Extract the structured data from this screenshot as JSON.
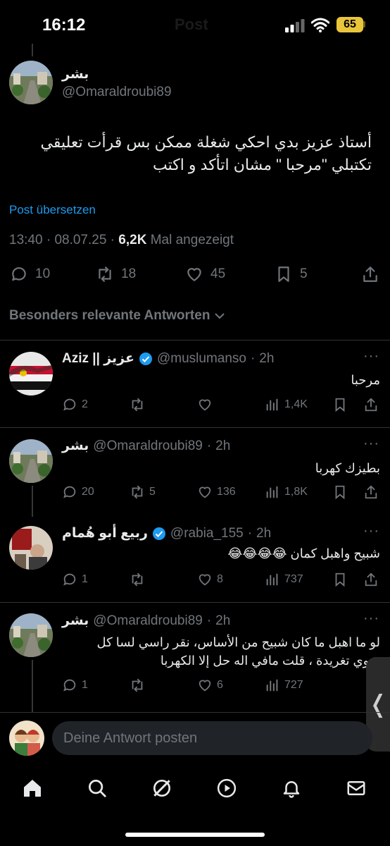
{
  "status_bar": {
    "time": "16:12",
    "faded_title": "Post",
    "battery": "65"
  },
  "post": {
    "author_name": "بشر",
    "author_handle": "@Omaraldroubi89",
    "text": "أستاذ عزيز بدي احكي شغلة ممكن بس قرأت تعليقي تكتبلي \"مرحبا \" مشان اتأكد و اكتب",
    "translate": "Post übersetzen",
    "time": "13:40",
    "date": "08.07.25",
    "views": "6,2K",
    "views_label": "Mal angezeigt",
    "stats": {
      "replies": "10",
      "reposts": "18",
      "likes": "45",
      "bookmarks": "5"
    }
  },
  "relevant_label": "Besonders relevante Antworten",
  "replies": [
    {
      "name": "Aziz || عزيز",
      "verified": true,
      "handle": "@muslumanso",
      "time": "2h",
      "text": "مرحبا",
      "stats": {
        "replies": "2",
        "reposts": "",
        "likes": "",
        "views": "1,4K"
      }
    },
    {
      "name": "بشر",
      "verified": false,
      "handle": "@Omaraldroubi89",
      "time": "2h",
      "text": "بطيزك كهربا",
      "stats": {
        "replies": "20",
        "reposts": "5",
        "likes": "136",
        "views": "1,8K"
      }
    },
    {
      "name": "ربيع أبو هُمام",
      "verified": true,
      "handle": "@rabia_155",
      "time": "2h",
      "text": "شبيح واهبل كمان 😂😂😂😂",
      "stats": {
        "replies": "1",
        "reposts": "",
        "likes": "8",
        "views": "737"
      }
    },
    {
      "name": "بشر",
      "verified": false,
      "handle": "@Omaraldroubi89",
      "time": "2h",
      "text": "لو ما اهبل ما كان شبيح من الأساس، نقر راسي لسا كل شوي تغريدة ، قلت مافي اله حل إلا الكهربا",
      "stats": {
        "replies": "1",
        "reposts": "",
        "likes": "6",
        "views": "727"
      }
    }
  ],
  "composer": {
    "placeholder": "Deine Antwort posten"
  },
  "side_tab": "❬",
  "colors": {
    "accent": "#1d9bf0",
    "muted": "#71767b",
    "text": "#e7e9ea",
    "background": "#000000",
    "battery": "#e9c53b"
  },
  "icons": [
    "home-icon",
    "search-icon",
    "grok-icon",
    "video-icon",
    "bell-icon",
    "mail-icon"
  ]
}
